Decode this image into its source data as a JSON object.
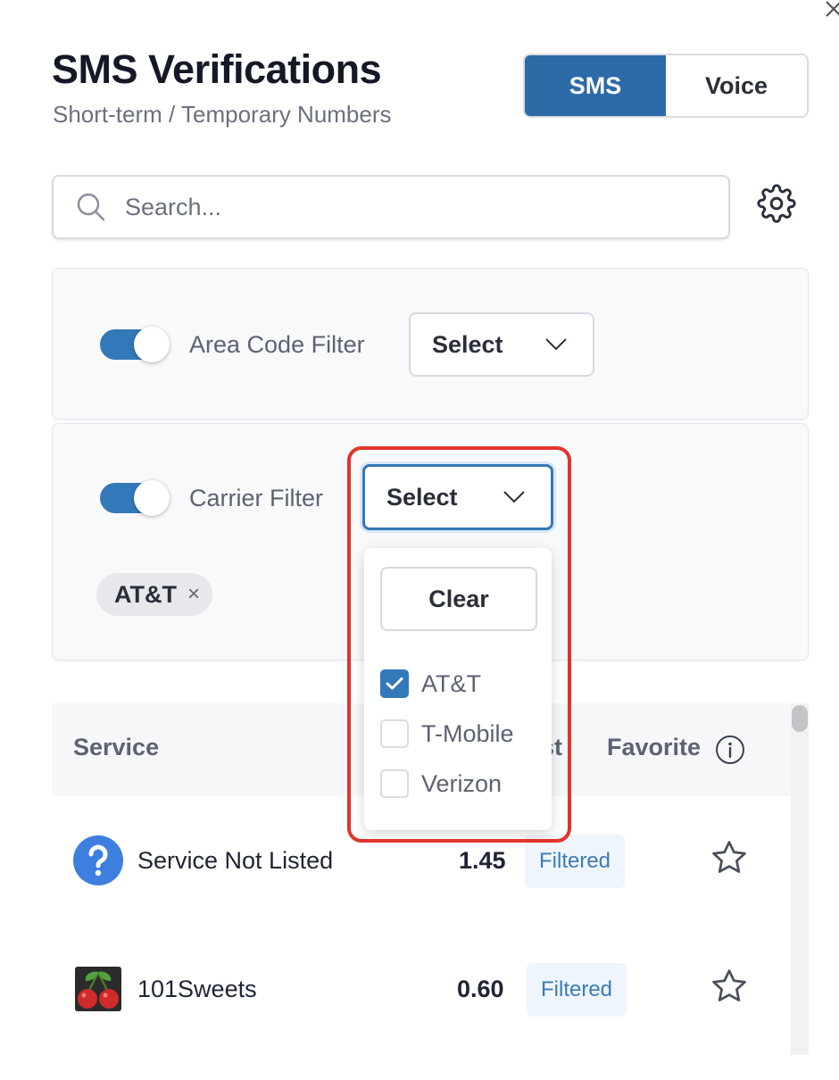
{
  "header": {
    "title": "SMS Verifications",
    "subtitle": "Short-term / Temporary Numbers"
  },
  "mode_toggle": {
    "options": [
      "SMS",
      "Voice"
    ],
    "selected": "SMS"
  },
  "search": {
    "placeholder": "Search...",
    "value": ""
  },
  "filters": {
    "area_code": {
      "label": "Area Code Filter",
      "enabled": true,
      "select_label": "Select"
    },
    "carrier": {
      "label": "Carrier Filter",
      "enabled": true,
      "select_label": "Select",
      "selected_chips": [
        "AT&T"
      ],
      "chip_remove": "×",
      "dropdown": {
        "clear_label": "Clear",
        "options": [
          {
            "label": "AT&T",
            "checked": true
          },
          {
            "label": "T-Mobile",
            "checked": false
          },
          {
            "label": "Verizon",
            "checked": false
          }
        ]
      }
    }
  },
  "table": {
    "headers": {
      "service": "Service",
      "cost_partial": "st",
      "favorite": "Favorite"
    },
    "rows": [
      {
        "icon": "question-icon",
        "name": "Service Not Listed",
        "cost": "1.45",
        "status": "Filtered",
        "favorite": false
      },
      {
        "icon": "cherry-icon",
        "name": "101Sweets",
        "cost": "0.60",
        "status": "Filtered",
        "favorite": false
      }
    ]
  },
  "colors": {
    "primary": "#2c6aa8",
    "toggle_on": "#3378b8",
    "highlight": "#e0352b",
    "badge_bg": "#eef5fc",
    "badge_text": "#3c7ab8"
  }
}
